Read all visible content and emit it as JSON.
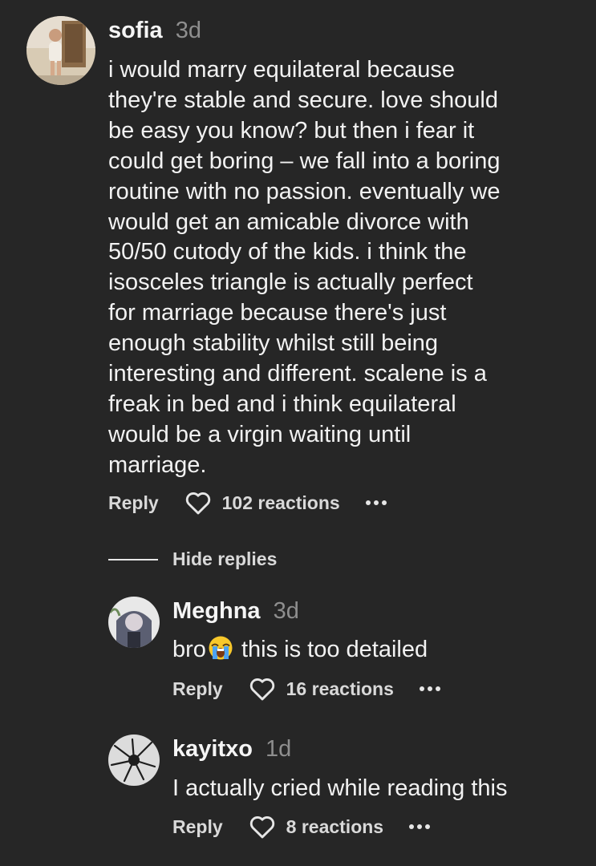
{
  "comments": {
    "main": {
      "username": "sofia",
      "time": "3d",
      "lines": [
        "i would marry equilateral because",
        "they're stable and secure. love should",
        "be easy you know? but then i fear it",
        "could get boring – we fall into a boring",
        "routine with no passion. eventually we",
        "would get an amicable divorce with",
        "50/50 cutody of the kids. i think the",
        "isosceles triangle is actually perfect",
        "for marriage because there's just",
        "enough stability whilst still being",
        "interesting and different. scalene is a",
        "freak in bed and i think equilateral",
        "would be a virgin waiting until",
        "marriage."
      ],
      "reply_label": "Reply",
      "reactions": "102 reactions"
    },
    "hide_replies_label": "Hide replies",
    "replies": [
      {
        "username": "Meghna",
        "time": "3d",
        "text_before_emoji": "bro",
        "emoji": "loudly-crying-face",
        "text_after_emoji": " this is too detailed",
        "reply_label": "Reply",
        "reactions": "16 reactions"
      },
      {
        "username": "kayitxo",
        "time": "1d",
        "text": "I actually cried while reading this",
        "reply_label": "Reply",
        "reactions": "8 reactions"
      }
    ]
  },
  "colors": {
    "background": "#262626",
    "text": "#f2f2f2",
    "muted": "#8e8e8e"
  }
}
